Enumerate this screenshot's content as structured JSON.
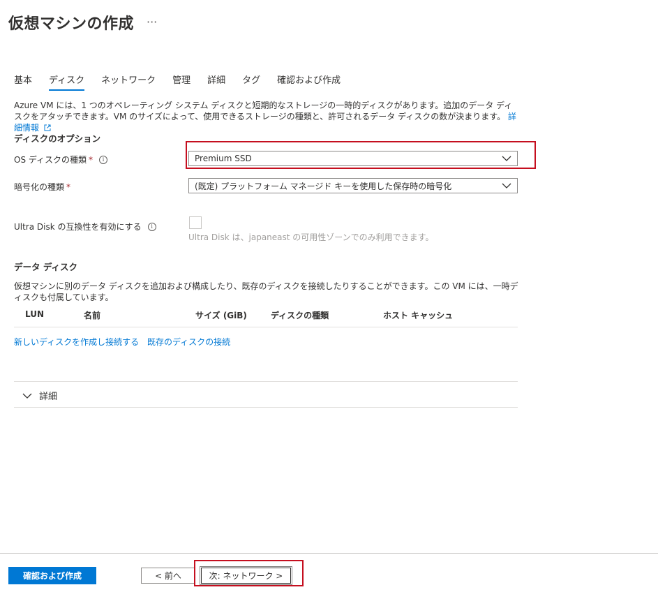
{
  "page": {
    "title": "仮想マシンの作成",
    "more": "···"
  },
  "tabs": [
    {
      "label": "基本"
    },
    {
      "label": "ディスク",
      "active": true
    },
    {
      "label": "ネットワーク"
    },
    {
      "label": "管理"
    },
    {
      "label": "詳細"
    },
    {
      "label": "タグ"
    },
    {
      "label": "確認および作成"
    }
  ],
  "intro": {
    "text": "Azure VM には、1 つのオペレーティング システム ディスクと短期的なストレージの一時的ディスクがあります。追加のデータ ディスクをアタッチできます。VM のサイズによって、使用できるストレージの種類と、許可されるデータ ディスクの数が決まります。",
    "link": "詳細情報"
  },
  "disk_options": {
    "heading": "ディスクのオプション",
    "os_disk_label": "OS ディスクの種類",
    "os_disk_value": "Premium SSD",
    "encryption_label": "暗号化の種類",
    "encryption_value": "(既定) プラットフォーム マネージド キーを使用した保存時の暗号化",
    "ultra_label": "Ultra Disk の互換性を有効にする",
    "ultra_note": "Ultra Disk は、japaneast の可用性ゾーンでのみ利用できます。"
  },
  "data_disks": {
    "heading": "データ ディスク",
    "text": "仮想マシンに別のデータ ディスクを追加および構成したり、既存のディスクを接続したりすることができます。この VM には、一時ディスクも付属しています。",
    "columns": [
      "LUN",
      "名前",
      "サイズ (GiB)",
      "ディスクの種類",
      "ホスト キャッシュ"
    ],
    "create_link": "新しいディスクを作成し接続する",
    "attach_link": "既存のディスクの接続"
  },
  "advanced": {
    "label": "詳細"
  },
  "footer": {
    "review_button": "確認および作成",
    "prev_button": "< 前へ",
    "next_button": "次: ネットワーク >"
  },
  "colors": {
    "accent": "#0078d4",
    "highlight": "#c50f1f"
  }
}
